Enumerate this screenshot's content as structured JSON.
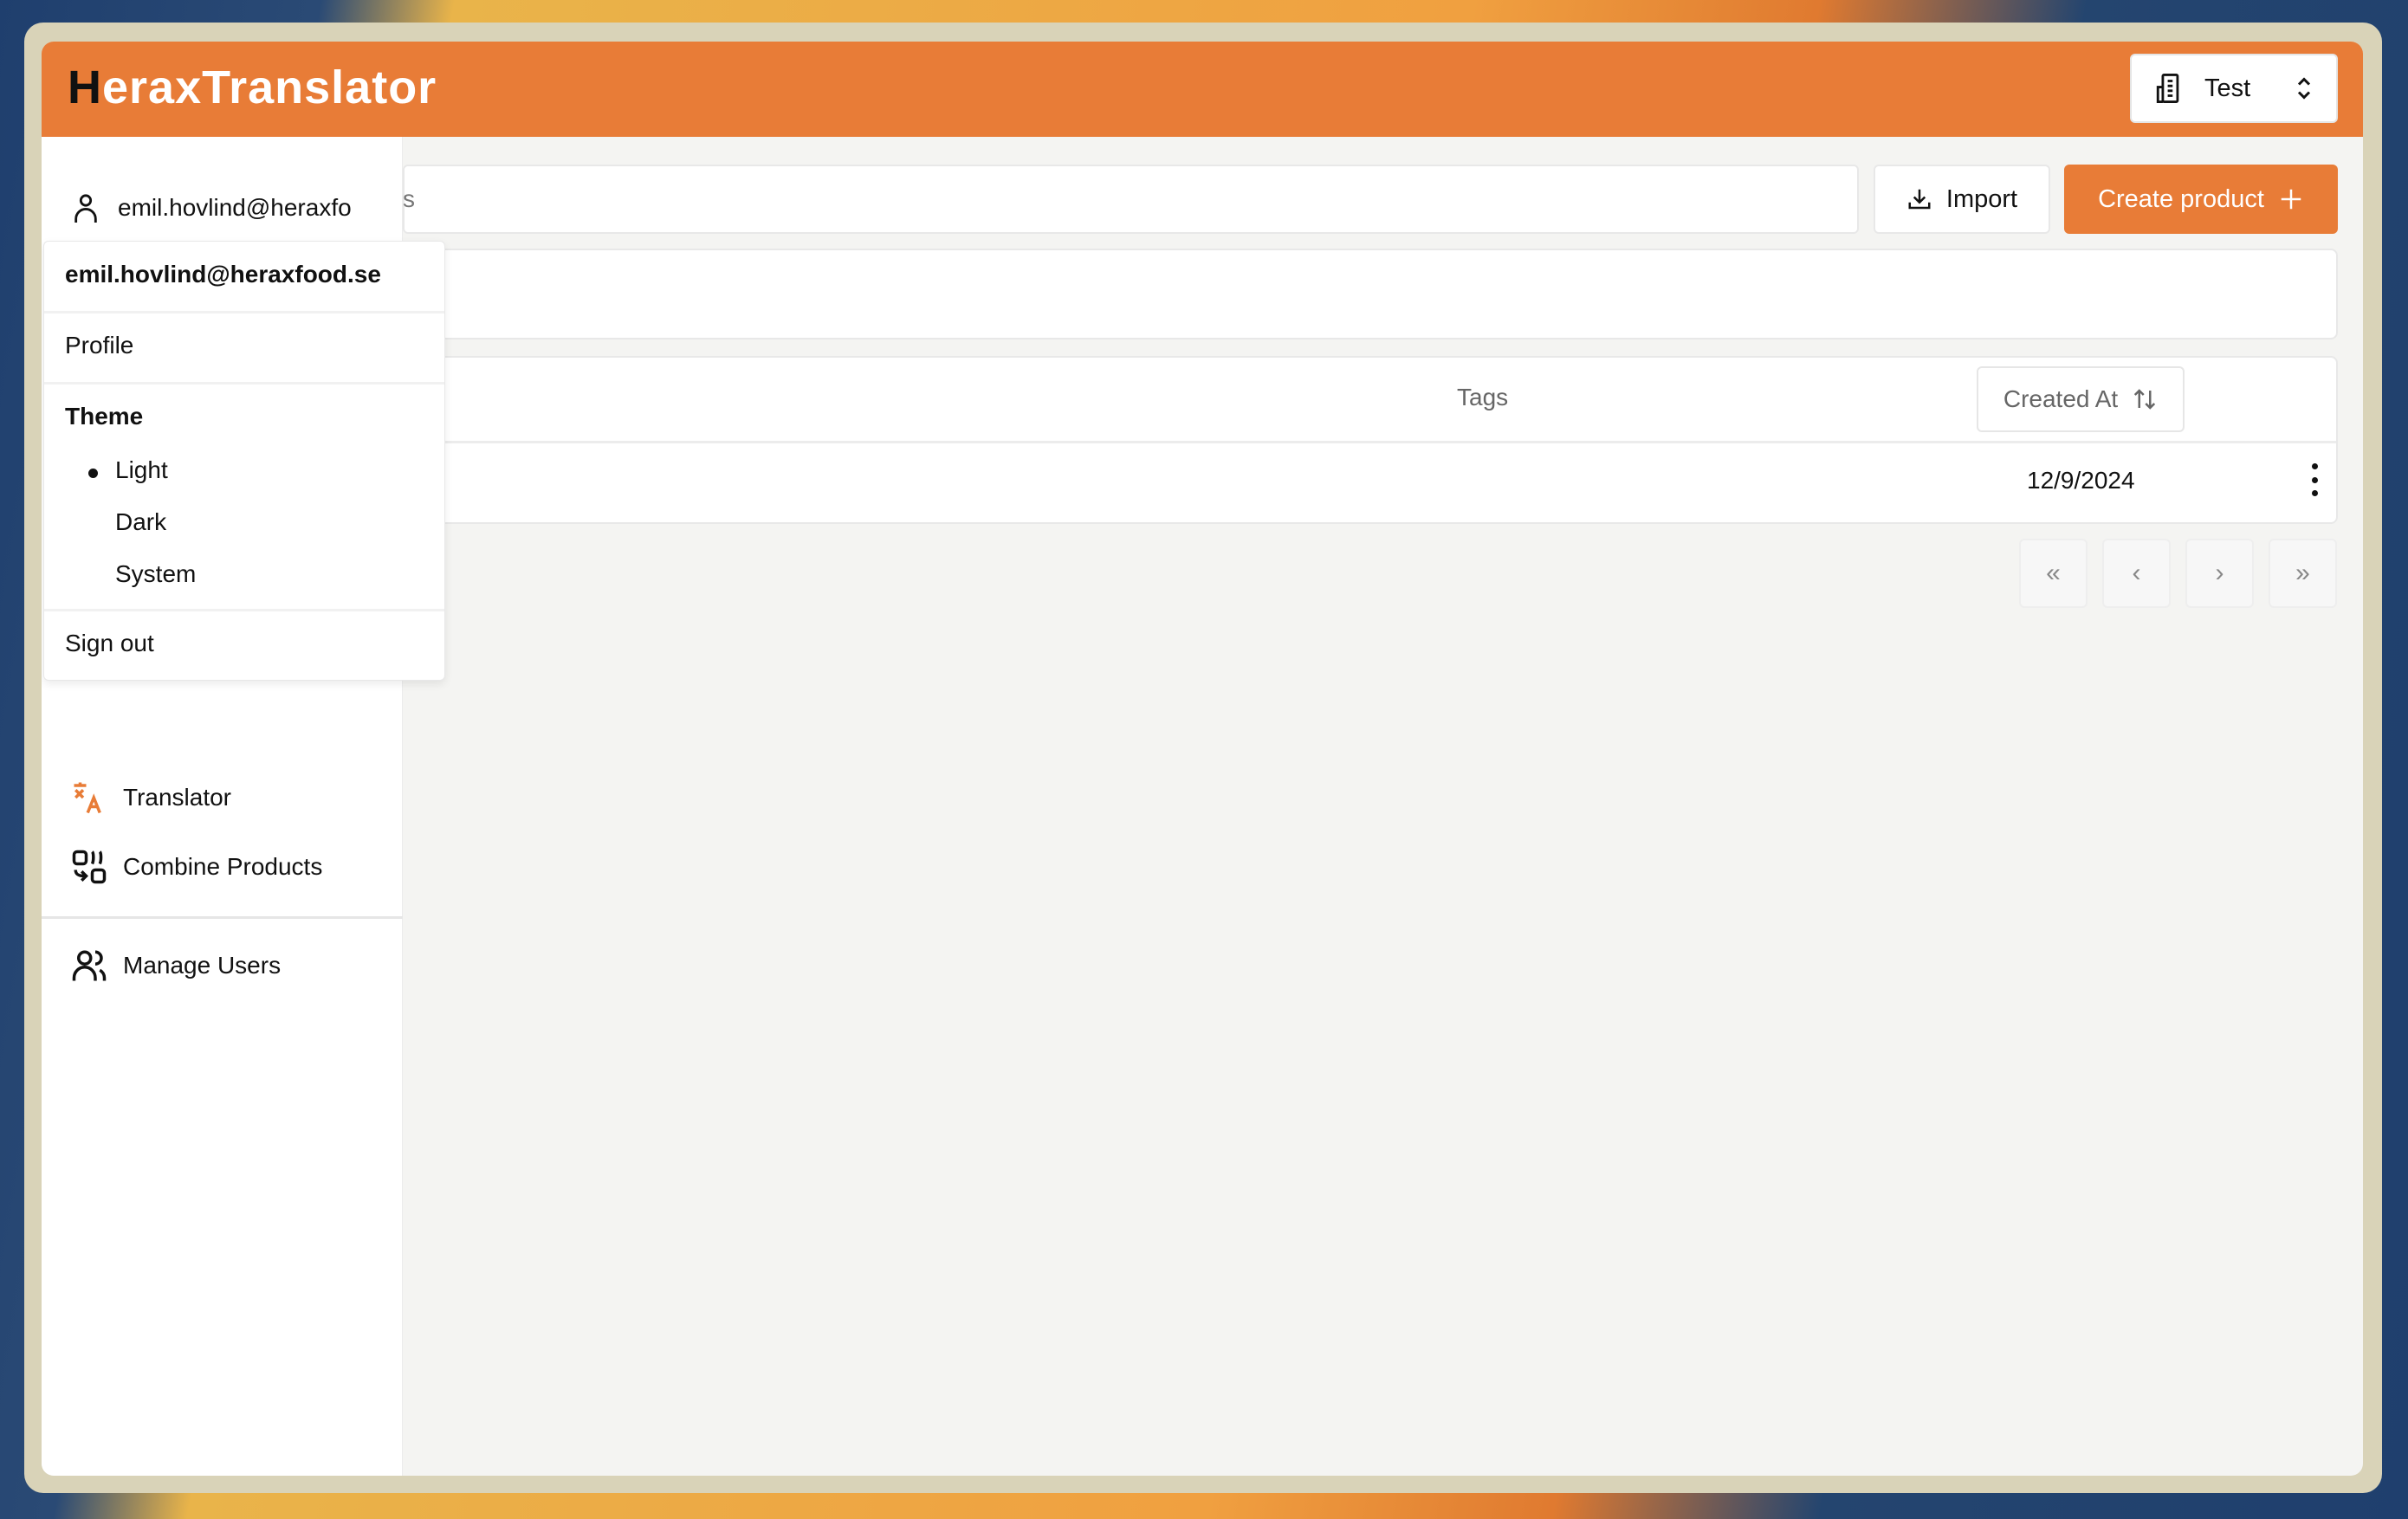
{
  "app": {
    "title_first": "H",
    "title_rest": "eraxTranslator",
    "accent": "#e87c37"
  },
  "org_selector": {
    "label": "Test",
    "icon": "building-icon"
  },
  "sidebar": {
    "user_email": "emil.hovlind@heraxfo",
    "items": [
      {
        "label": "Translator",
        "icon": "languages-icon"
      },
      {
        "label": "Combine Products",
        "icon": "combine-icon"
      },
      {
        "label": "Manage Users",
        "icon": "users-icon"
      }
    ]
  },
  "user_menu": {
    "email": "emil.hovlind@heraxfood.se",
    "profile": "Profile",
    "theme_heading": "Theme",
    "themes": [
      "Light",
      "Dark",
      "System"
    ],
    "selected_theme": "Light",
    "sign_out": "Sign out"
  },
  "toolbar": {
    "search_visible_text": "s",
    "import_label": "Import",
    "create_label": "Create product"
  },
  "table": {
    "columns": [
      "Tags",
      "Created At"
    ],
    "rows": [
      {
        "created_at": "12/9/2024"
      }
    ]
  },
  "pagination": [
    "«",
    "‹",
    "›",
    "»"
  ]
}
